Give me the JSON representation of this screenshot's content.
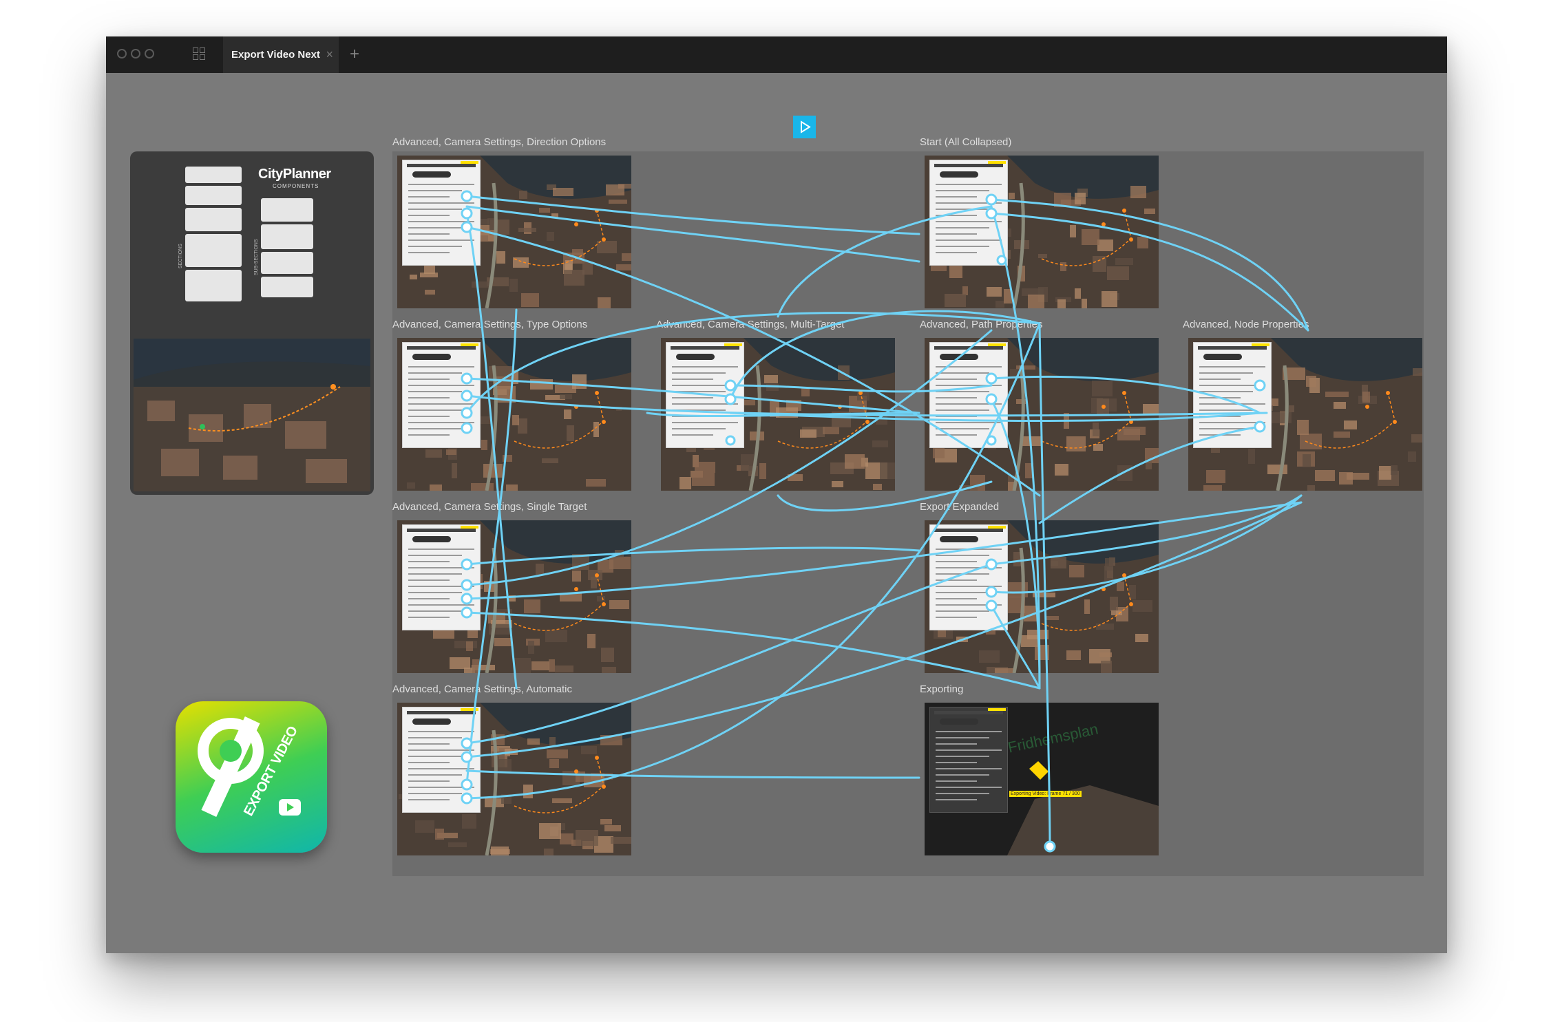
{
  "window": {
    "tab_title": "Export Video Next",
    "tab_close": "×",
    "add_tab": "+"
  },
  "cover": {
    "logo": "CityPlanner",
    "logo_sub": "COMPONENTS",
    "side_label_left": "SECTIONS",
    "side_label_right": "SUB-SECTIONS"
  },
  "app_icon": {
    "label": "EXPORT VIDEO"
  },
  "frames": [
    {
      "id": "dir",
      "label": "Advanced, Camera Settings, Direction Options"
    },
    {
      "id": "start",
      "label": "Start (All Collapsed)"
    },
    {
      "id": "type",
      "label": "Advanced, Camera Settings, Type Options"
    },
    {
      "id": "multi",
      "label": "Advanced, Camera Settings, Multi-Target"
    },
    {
      "id": "path",
      "label": "Advanced, Path Properties"
    },
    {
      "id": "node",
      "label": "Advanced, Node Properties"
    },
    {
      "id": "single",
      "label": "Advanced, Camera Settings, Single Target"
    },
    {
      "id": "export",
      "label": "Export Expanded"
    },
    {
      "id": "auto",
      "label": "Advanced, Camera Settings, Automatic"
    },
    {
      "id": "exporting",
      "label": "Exporting"
    }
  ],
  "exporting_overlay": {
    "status": "Exporting Video: Frame 71 / 300",
    "map_label": "Fridhemsplan"
  },
  "colors": {
    "wire": "#6fd2f5",
    "canvas": "#7a7a7a",
    "play": "#19b6ea"
  },
  "icons": [
    "traffic-light-icon",
    "grid-icon",
    "close-icon",
    "plus-icon",
    "play-icon"
  ]
}
